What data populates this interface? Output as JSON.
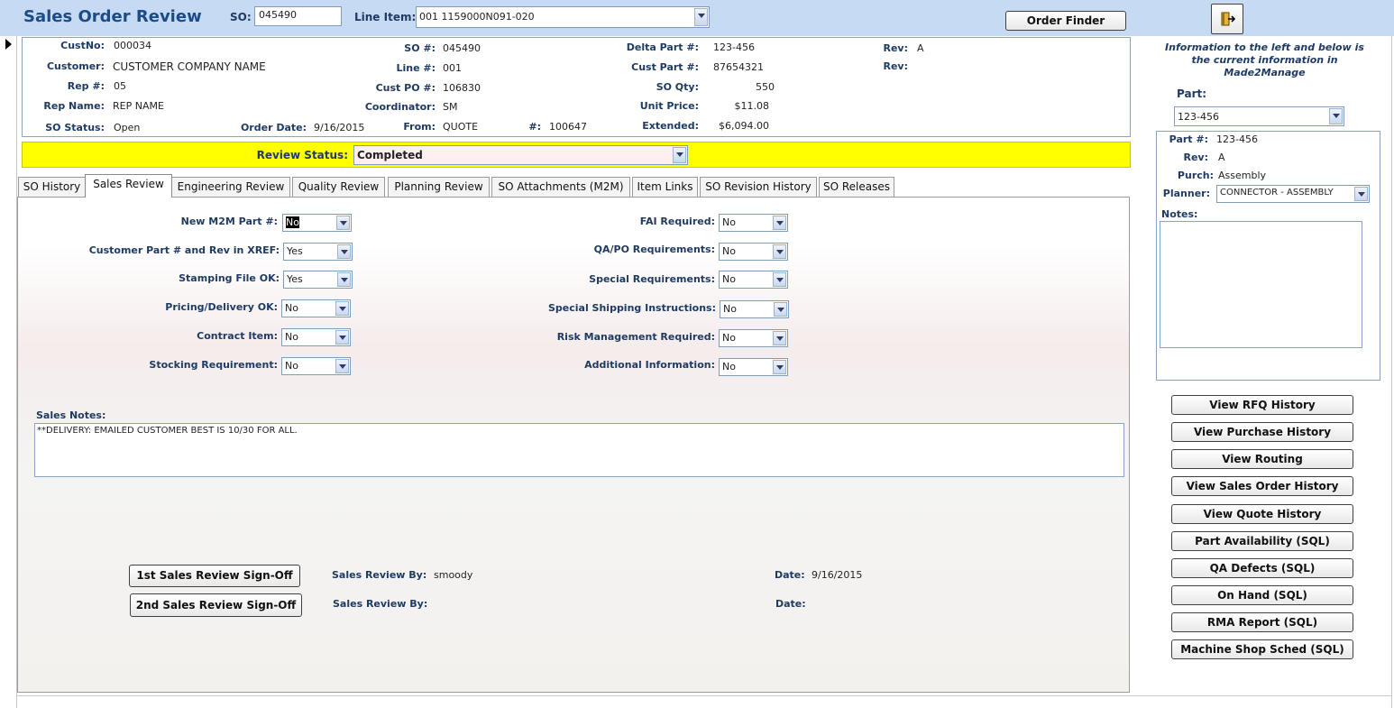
{
  "header": {
    "title": "Sales Order Review",
    "so_label": "SO:",
    "so_value": "045490",
    "line_item_label": "Line Item:",
    "line_item_value": "001 1159000N091-020",
    "order_finder": "Order Finder"
  },
  "info": {
    "custno_label": "CustNo:",
    "custno": "000034",
    "customer_label": "Customer:",
    "customer": "CUSTOMER COMPANY NAME",
    "rep_label": "Rep #:",
    "rep": "05",
    "repname_label": "Rep Name:",
    "repname": "REP NAME",
    "sostatus_label": "SO Status:",
    "sostatus": "Open",
    "orderdate_label": "Order Date:",
    "orderdate": "9/16/2015",
    "so_num_label": "SO #:",
    "so_num": "045490",
    "line_label": "Line #:",
    "line": "001",
    "custpo_label": "Cust PO #:",
    "custpo": "106830",
    "coordinator_label": "Coordinator:",
    "coordinator": "SM",
    "from_label": "From:",
    "from": "QUOTE",
    "hash_label": "#:",
    "hash": "100647",
    "deltapart_label": "Delta Part #:",
    "deltapart": "123-456",
    "custpart_label": "Cust Part #:",
    "custpart": "87654321",
    "soqty_label": "SO Qty:",
    "soqty": "550",
    "unitprice_label": "Unit Price:",
    "unitprice": "$11.08",
    "extended_label": "Extended:",
    "extended": "$6,094.00",
    "rev1_label": "Rev:",
    "rev1": "A",
    "rev2_label": "Rev:",
    "rev2": ""
  },
  "review": {
    "label": "Review Status:",
    "value": "Completed"
  },
  "tabs": [
    {
      "label": "SO History"
    },
    {
      "label": "Sales Review"
    },
    {
      "label": "Engineering Review"
    },
    {
      "label": "Quality Review"
    },
    {
      "label": "Planning Review"
    },
    {
      "label": "SO Attachments (M2M)"
    },
    {
      "label": "Item Links"
    },
    {
      "label": "SO Revision History"
    },
    {
      "label": "SO Releases"
    }
  ],
  "sales_review": {
    "left_fields": [
      {
        "label": "New M2M Part #:",
        "value": "No"
      },
      {
        "label": "Customer Part # and Rev in XREF:",
        "value": "Yes"
      },
      {
        "label": "Stamping File OK:",
        "value": "Yes"
      },
      {
        "label": "Pricing/Delivery OK:",
        "value": "No"
      },
      {
        "label": "Contract Item:",
        "value": "No"
      },
      {
        "label": "Stocking Requirement:",
        "value": "No"
      }
    ],
    "right_fields": [
      {
        "label": "FAI Required:",
        "value": "No"
      },
      {
        "label": "QA/PO Requirements:",
        "value": "No"
      },
      {
        "label": "Special Requirements:",
        "value": "No"
      },
      {
        "label": "Special Shipping Instructions:",
        "value": "No"
      },
      {
        "label": "Risk Management Required:",
        "value": "No"
      },
      {
        "label": "Additional Information:",
        "value": "No"
      }
    ],
    "notes_label": "Sales Notes:",
    "notes_text": "**DELIVERY:  EMAILED CUSTOMER BEST IS 10/30 FOR ALL.",
    "signoff1_button": "1st Sales Review Sign-Off",
    "signoff2_button": "2nd Sales Review Sign-Off",
    "reviewby1_label": "Sales Review By:",
    "reviewby1": "smoody",
    "reviewby2_label": "Sales Review By:",
    "reviewby2": "",
    "date1_label": "Date:",
    "date1": "9/16/2015",
    "date2_label": "Date:",
    "date2": ""
  },
  "right_panel": {
    "info_text": "Information to the left and below is the current information in Made2Manage",
    "part_label": "Part:",
    "part_value": "123-456",
    "part_num_label": "Part #:",
    "part_num": "123-456",
    "rev_label": "Rev:",
    "rev": "A",
    "purch_label": "Purch:",
    "purch": "Assembly",
    "planner_label": "Planner:",
    "planner": "CONNECTOR - ASSEMBLY",
    "notes_label": "Notes:"
  },
  "right_buttons": [
    {
      "label": "View RFQ History"
    },
    {
      "label": "View Purchase History"
    },
    {
      "label": "View Routing"
    },
    {
      "label": "View Sales Order History"
    },
    {
      "label": "View Quote History"
    },
    {
      "label": "Part Availability (SQL)"
    },
    {
      "label": "QA Defects (SQL)"
    },
    {
      "label": "On Hand (SQL)"
    },
    {
      "label": "RMA Report  (SQL)"
    },
    {
      "label": "Machine Shop Sched (SQL)"
    }
  ],
  "icons": {
    "exit": "exit-door-icon",
    "record": "record-selector-arrow-icon",
    "dropdown": "chevron-down-icon"
  }
}
